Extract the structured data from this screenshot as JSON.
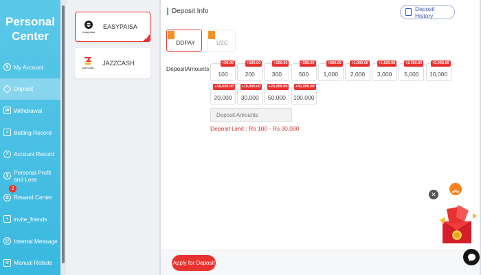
{
  "sidebar": {
    "title_line1": "Personal",
    "title_line2": "Center",
    "items": [
      {
        "label": "My Account"
      },
      {
        "label": "Deposit"
      },
      {
        "label": "Withdrawal"
      },
      {
        "label": "Betting Record"
      },
      {
        "label": "Account Record"
      },
      {
        "label": "Personal Profit and Loss"
      },
      {
        "label": "Reward Center",
        "badge": "2"
      },
      {
        "label": "invite_friends"
      },
      {
        "label": "Internal Message"
      },
      {
        "label": "Manual Rebate"
      }
    ]
  },
  "methods": [
    {
      "name": "EASYPAISA",
      "logo_text": "easypaisa"
    },
    {
      "name": "JAZZCASH",
      "logo_text": "JazzCash"
    }
  ],
  "main": {
    "header": "Deposit Info",
    "history_button": "Deposit History",
    "channels": [
      {
        "label": "DDPAY"
      },
      {
        "label": "U2C"
      }
    ],
    "amounts_label": "DepositAmounts :",
    "amounts": [
      {
        "value": "100",
        "bonus": "+50.00"
      },
      {
        "value": "200",
        "bonus": "+100.00"
      },
      {
        "value": "300",
        "bonus": "+150.00"
      },
      {
        "value": "500",
        "bonus": "+250.00"
      },
      {
        "value": "1,000",
        "bonus": "+500.00"
      },
      {
        "value": "2,000",
        "bonus": "+1,000.00"
      },
      {
        "value": "3,000",
        "bonus": "+1,500.00"
      },
      {
        "value": "5,000",
        "bonus": "+2,500.00"
      },
      {
        "value": "10,000",
        "bonus": "+5,000.00"
      },
      {
        "value": "20,000",
        "bonus": "+10,000.00"
      },
      {
        "value": "30,000",
        "bonus": "+15,000.00"
      },
      {
        "value": "50,000",
        "bonus": "+25,000.00"
      },
      {
        "value": "100,000",
        "bonus": "+50,000.00"
      }
    ],
    "input_placeholder": "Deposit Amounts",
    "deposit_limit": "Deposit Limit :  Rs  100  -  Rs  30,000",
    "apply_button": "Apply for Deposit"
  },
  "colors": {
    "sidebar": "#3ab8e0",
    "accent": "#e8322f",
    "header_bar": "#2ec46a",
    "history": "#3a5bb8"
  }
}
